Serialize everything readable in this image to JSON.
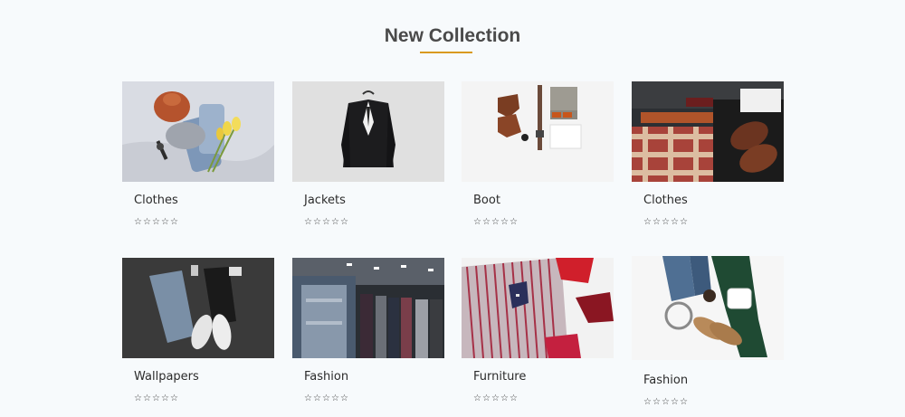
{
  "section": {
    "title": "New Collection",
    "accent_color": "#d99a1f"
  },
  "rating": {
    "star_icon": "☆",
    "max_stars": 5
  },
  "products": [
    {
      "name": "Clothes",
      "rating": 0,
      "image": "flatlay-knit-hat-jeans-tulips"
    },
    {
      "name": "Jackets",
      "rating": 0,
      "image": "black-blazer-on-hanger"
    },
    {
      "name": "Boot",
      "rating": 0,
      "image": "brown-boots-belt-sunglasses-flatlay"
    },
    {
      "name": "Clothes",
      "rating": 0,
      "image": "plaid-shirt-leather-shoes-box"
    },
    {
      "name": "Wallpapers",
      "rating": 0,
      "image": "jeans-sneakers-dark-background"
    },
    {
      "name": "Fashion",
      "rating": 0,
      "image": "clothing-rack-store"
    },
    {
      "name": "Furniture",
      "rating": 0,
      "image": "striped-shirt-red-ties"
    },
    {
      "name": "Fashion",
      "rating": 0,
      "image": "loafers-belt-mug-flatlay"
    }
  ]
}
